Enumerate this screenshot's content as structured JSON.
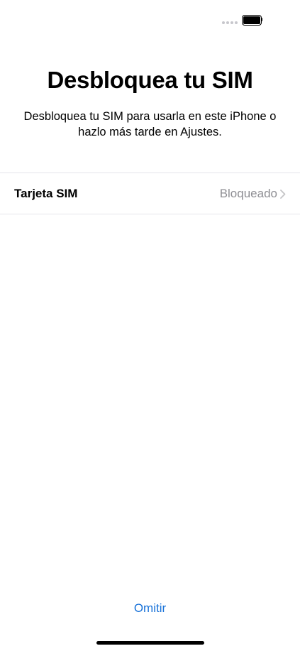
{
  "status_bar": {
    "signal_icon": "signal-dots-icon",
    "battery_icon": "battery-full-icon",
    "battery_level": 1.0
  },
  "header": {
    "title": "Desbloquea tu SIM",
    "subtitle": "Desbloquea tu SIM para usarla en este iPhone o hazlo más tarde en Ajustes."
  },
  "sim_row": {
    "label": "Tarjeta SIM",
    "value": "Bloqueado",
    "chevron_icon": "chevron-right-icon"
  },
  "footer": {
    "skip_label": "Omitir",
    "accent_color": "#1a73d9"
  }
}
